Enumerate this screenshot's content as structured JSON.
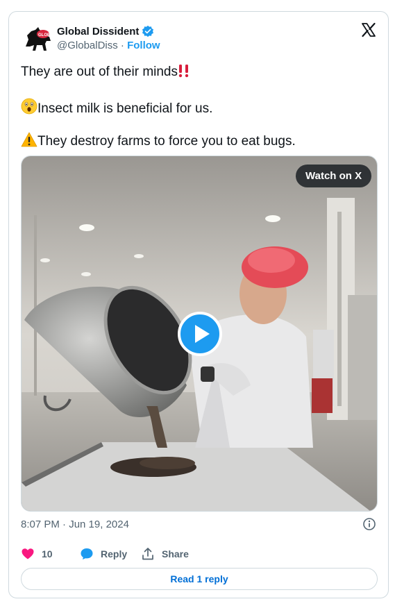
{
  "author": {
    "display_name": "Global Dissident",
    "handle": "@GlobalDiss",
    "separator": " · ",
    "follow_label": "Follow",
    "avatar_icon": "horse-avatar-icon",
    "verified_icon": "verified-badge-icon",
    "verified_color": "#1d9bf0"
  },
  "platform": {
    "logo_icon": "x-logo-icon"
  },
  "tweet": {
    "line1": "They are out of their minds",
    "line1_emoji": "double-exclamation-emoji",
    "line2": "Insect milk is beneficial for us.",
    "line2_emoji": "astonished-face-emoji",
    "line3": "They destroy farms to force you to eat bugs.",
    "line3_emoji": "warning-emoji"
  },
  "media": {
    "type": "video",
    "watch_label": "Watch on X",
    "play_icon": "play-icon"
  },
  "meta": {
    "timestamp": "8:07 PM · Jun 19, 2024",
    "info_icon": "info-icon"
  },
  "actions": {
    "like_count": "10",
    "like_color": "#f91880",
    "reply_label": "Reply",
    "share_label": "Share"
  },
  "footer": {
    "read_replies_label": "Read 1 reply",
    "accent_color": "#006fd6"
  }
}
